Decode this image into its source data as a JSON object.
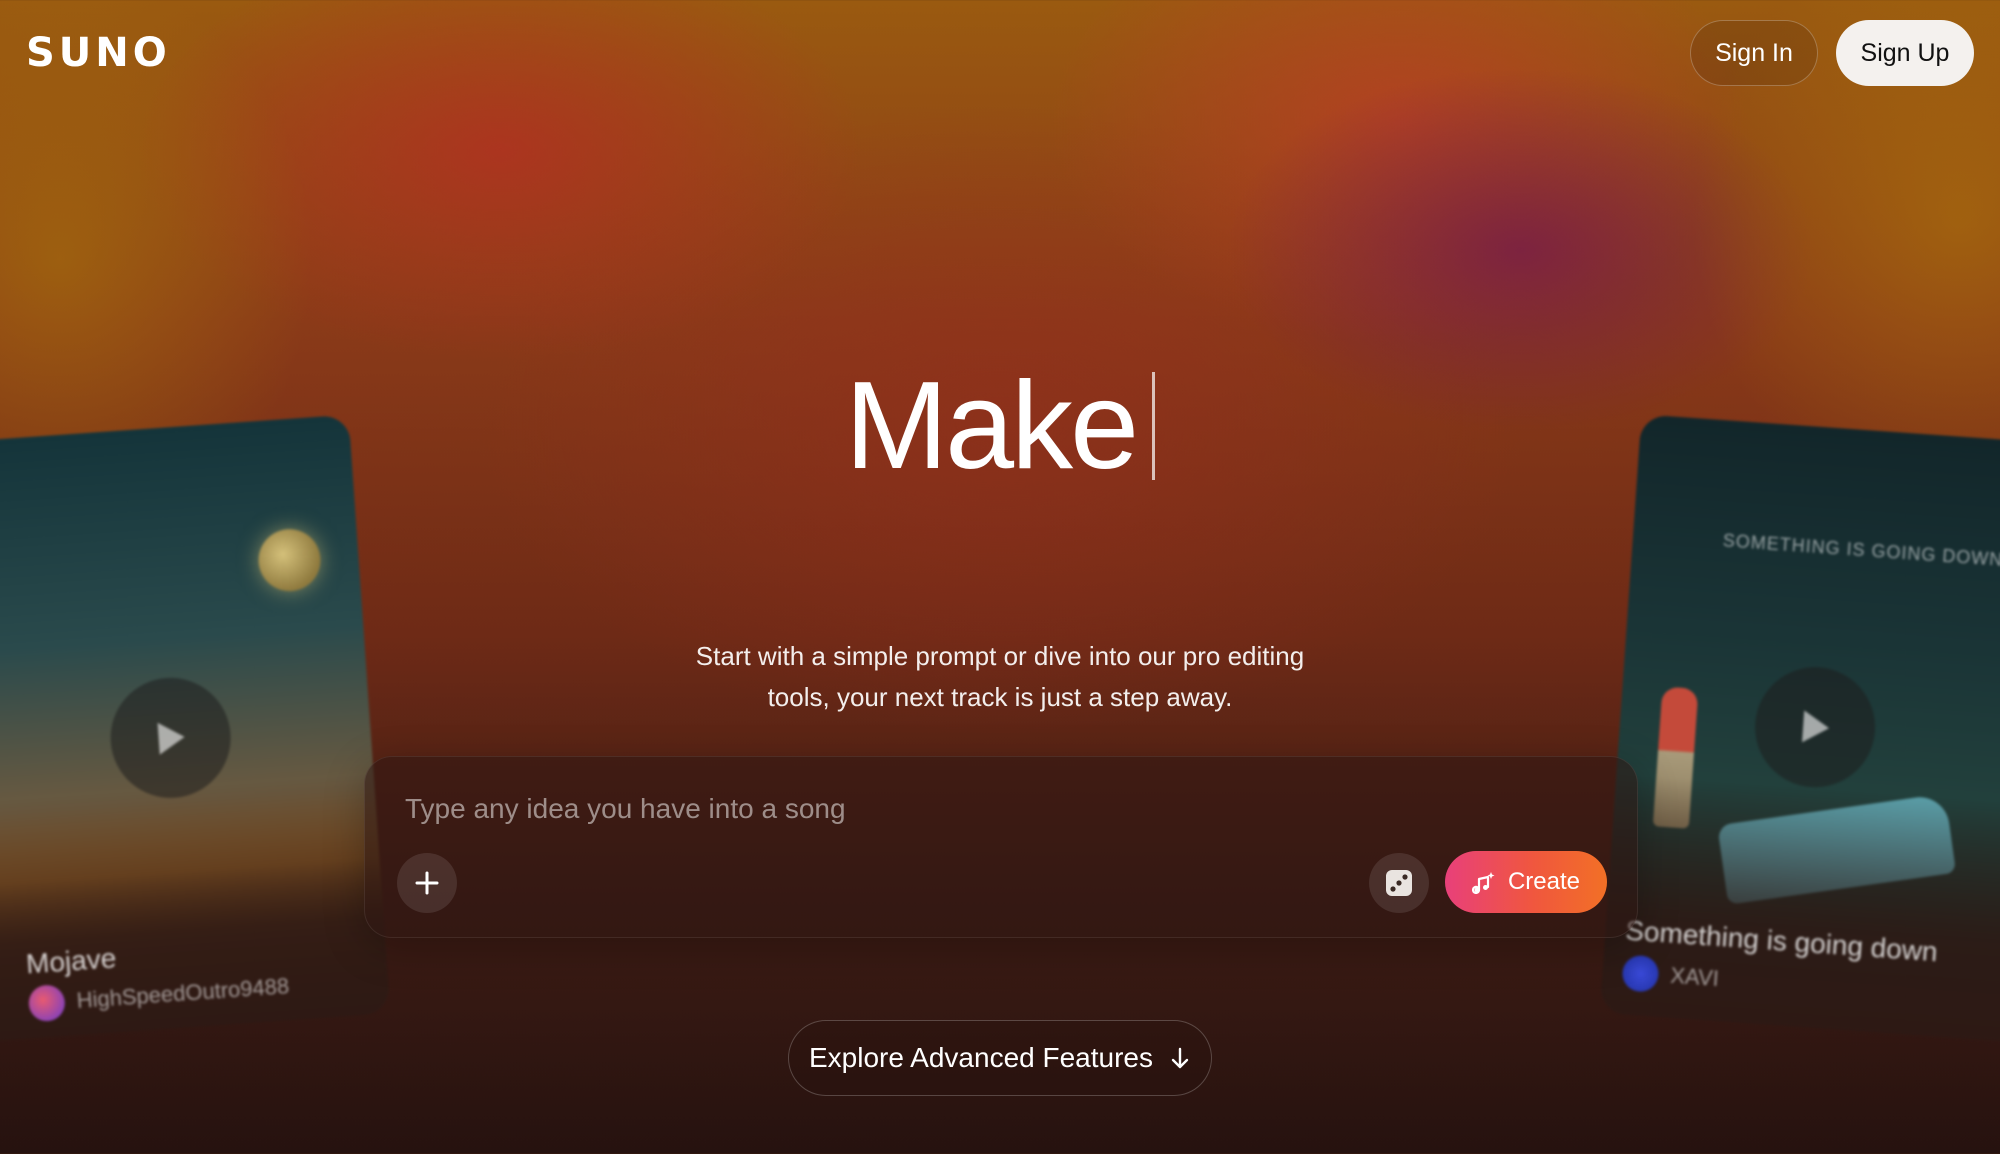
{
  "header": {
    "logo": "SUNO",
    "sign_in": "Sign In",
    "sign_up": "Sign Up"
  },
  "hero": {
    "title": "Make",
    "subtitle_line1": "Start with a simple prompt or dive into our pro editing",
    "subtitle_line2": "tools, your next track is just a step away."
  },
  "prompt": {
    "placeholder": "Type any idea you have into a song",
    "value": "",
    "add_icon": "plus-icon",
    "random_icon": "dice-icon",
    "create_label": "Create",
    "create_icon": "music-sparkle-icon"
  },
  "explore": {
    "label": "Explore Advanced Features",
    "icon": "arrow-down-icon"
  },
  "cards": [
    {
      "title": "Mojave",
      "artist": "HighSpeedOutro9488"
    },
    {
      "title": "Something is going down",
      "artist": "XAVI",
      "banner": "SOMETHING IS GOING DOWN"
    }
  ],
  "colors": {
    "create_gradient_start": "#e8407a",
    "create_gradient_end": "#f27026",
    "signup_bg": "#f4f1ee"
  }
}
